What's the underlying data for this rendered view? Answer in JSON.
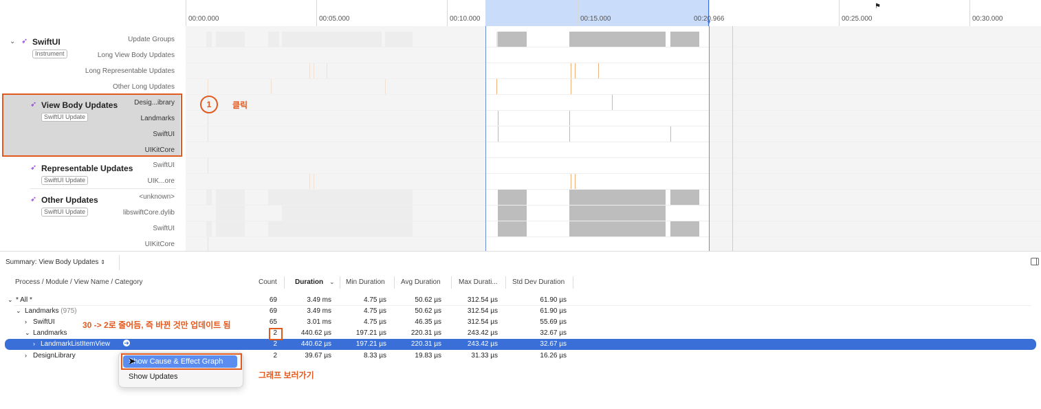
{
  "timeline": {
    "ticks": [
      "00:00.000",
      "00:05.000",
      "00:10.000",
      "00:15.000",
      "00:20.966",
      "00:25.000",
      "00:30.000"
    ],
    "flag_icon": "flag-icon"
  },
  "groups": [
    {
      "title": "SwiftUI",
      "badge": "Instrument",
      "tracks": [
        "Update Groups",
        "Long View Body Updates",
        "Long Representable Updates",
        "Other Long Updates"
      ]
    },
    {
      "title": "View Body Updates",
      "badge": "SwiftUI Update",
      "tracks": [
        "Desig...ibrary",
        "Landmarks",
        "SwiftUI",
        "UIKitCore"
      ]
    },
    {
      "title": "Representable Updates",
      "badge": "SwiftUI Update",
      "tracks": [
        "SwiftUI",
        "UIK...ore"
      ]
    },
    {
      "title": "Other Updates",
      "badge": "SwiftUI Update",
      "tracks": [
        "<unknown>",
        "libswiftCore.dylib",
        "SwiftUI",
        "UIKitCore"
      ]
    }
  ],
  "summary": {
    "label": "Summary: View Body Updates",
    "chevron": "⌃⌄",
    "sidebar_icon": "sidebar-toggle-icon"
  },
  "table": {
    "columns": [
      "Process / Module / View Name / Category",
      "Count",
      "Duration",
      "Min Duration",
      "Avg Duration",
      "Max Durati...",
      "Std Dev Duration"
    ],
    "rows": [
      {
        "name": "* All *",
        "sub": "",
        "count": "69",
        "duration": "3.49 ms",
        "min": "4.75 µs",
        "avg": "50.62 µs",
        "max": "312.54 µs",
        "std": "61.90 µs"
      },
      {
        "name": "Landmarks",
        "sub": "(975)",
        "count": "69",
        "duration": "3.49 ms",
        "min": "4.75 µs",
        "avg": "50.62 µs",
        "max": "312.54 µs",
        "std": "61.90 µs"
      },
      {
        "name": "SwiftUI",
        "sub": "",
        "count": "65",
        "duration": "3.01 ms",
        "min": "4.75 µs",
        "avg": "46.35 µs",
        "max": "312.54 µs",
        "std": "55.69 µs"
      },
      {
        "name": "Landmarks",
        "sub": "",
        "count": "2",
        "duration": "440.62 µs",
        "min": "197.21 µs",
        "avg": "220.31 µs",
        "max": "243.42 µs",
        "std": "32.67 µs"
      },
      {
        "name": "LandmarkListItemView",
        "sub": "",
        "count": "2",
        "duration": "440.62 µs",
        "min": "197.21 µs",
        "avg": "220.31 µs",
        "max": "243.42 µs",
        "std": "32.67 µs"
      },
      {
        "name": "DesignLibrary",
        "sub": "",
        "count": "2",
        "duration": "39.67 µs",
        "min": "8.33 µs",
        "avg": "19.83 µs",
        "max": "31.33 µs",
        "std": "16.26 µs"
      }
    ]
  },
  "context_menu": {
    "items": [
      "Show Cause & Effect Graph",
      "Show Updates"
    ]
  },
  "annotations": {
    "step_number": "1",
    "click_label": "클릭",
    "count_note": "30 -> 2로 줄어듬, 즉  바뀐 것만 업데이트 됨",
    "graph_note": "그래프 보러가기"
  },
  "colors": {
    "accent": "#3a6fd8",
    "annotation": "#e05a1f",
    "selection_range": "#c9dcfa",
    "swift_icon": "#8a2be2"
  }
}
